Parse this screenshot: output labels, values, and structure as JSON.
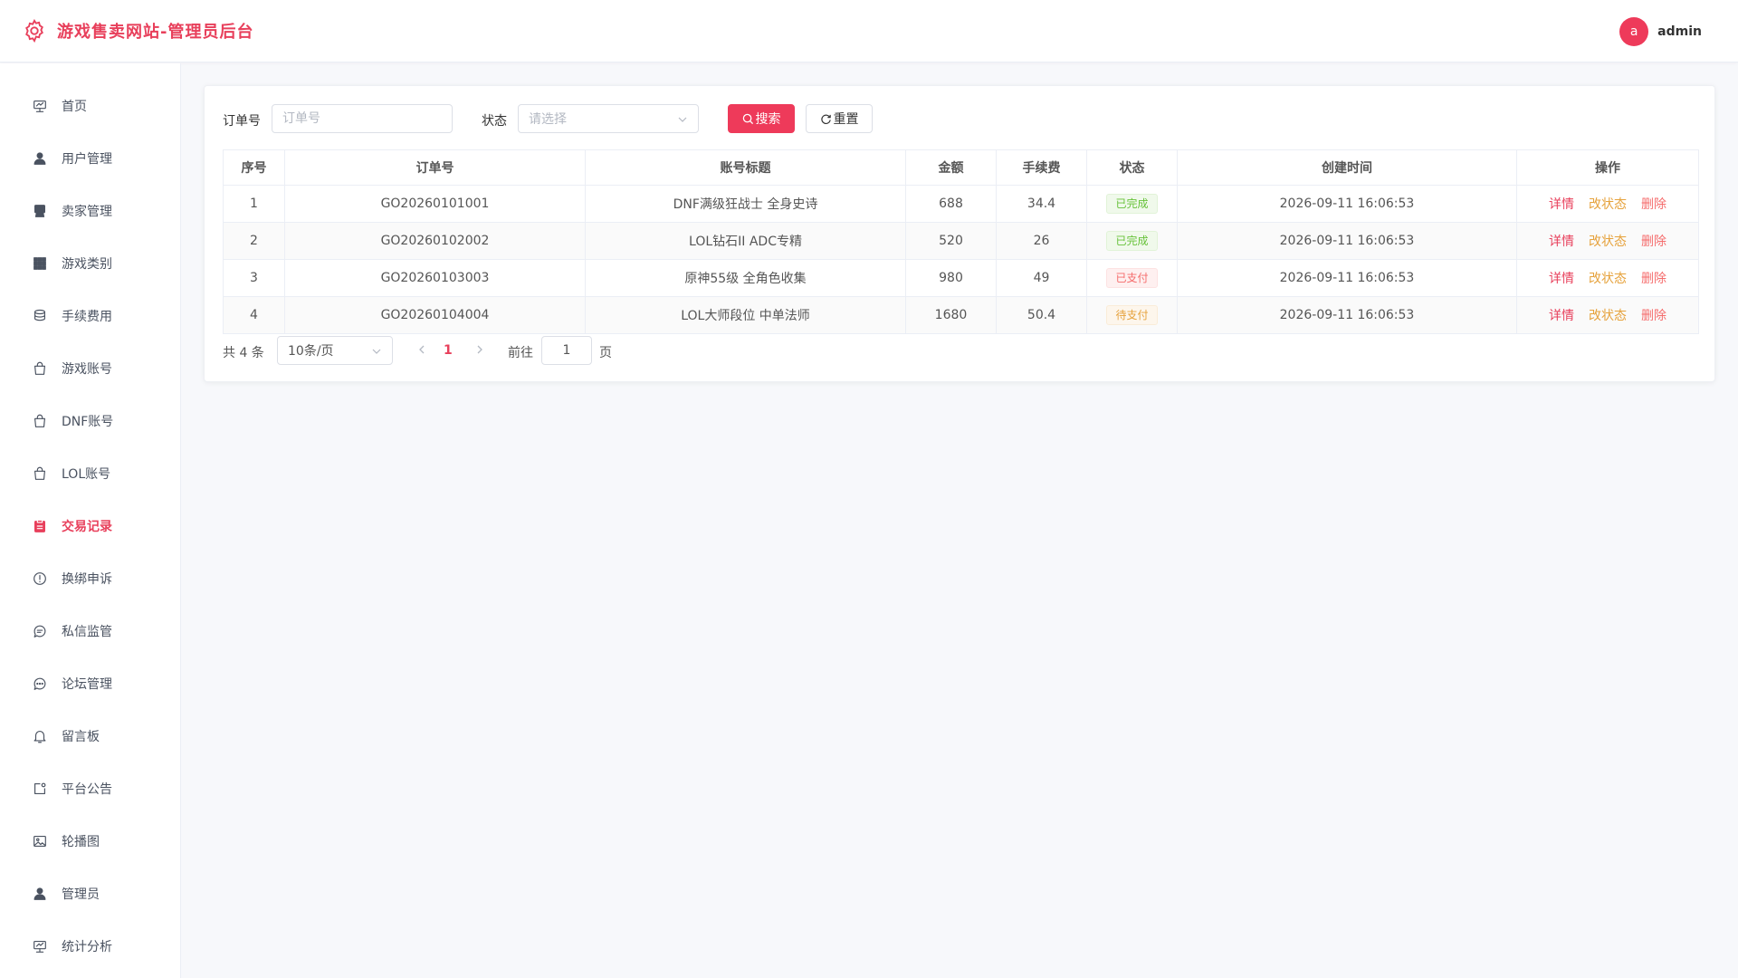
{
  "app": {
    "title": "游戏售卖网站-管理员后台",
    "brand_color": "#e83f5b"
  },
  "user": {
    "avatar_letter": "a",
    "name": "admin"
  },
  "sidebar": {
    "items": [
      {
        "label": "首页",
        "icon": "presentation-icon"
      },
      {
        "label": "用户管理",
        "icon": "user-icon"
      },
      {
        "label": "卖家管理",
        "icon": "seller-icon"
      },
      {
        "label": "游戏类别",
        "icon": "grid-icon"
      },
      {
        "label": "手续费用",
        "icon": "coins-icon"
      },
      {
        "label": "游戏账号",
        "icon": "bag-icon"
      },
      {
        "label": "DNF账号",
        "icon": "bag-icon"
      },
      {
        "label": "LOL账号",
        "icon": "bag-icon"
      },
      {
        "label": "交易记录",
        "icon": "clipboard-icon",
        "active": true
      },
      {
        "label": "换绑申诉",
        "icon": "alert-circle-icon"
      },
      {
        "label": "私信监管",
        "icon": "message-icon"
      },
      {
        "label": "论坛管理",
        "icon": "chat-dots-icon"
      },
      {
        "label": "留言板",
        "icon": "bell-icon"
      },
      {
        "label": "平台公告",
        "icon": "notice-icon"
      },
      {
        "label": "轮播图",
        "icon": "picture-icon"
      },
      {
        "label": "管理员",
        "icon": "user-icon"
      },
      {
        "label": "统计分析",
        "icon": "presentation-icon"
      }
    ]
  },
  "filters": {
    "order_label": "订单号",
    "order_placeholder": "订单号",
    "order_value": "",
    "status_label": "状态",
    "status_placeholder": "请选择",
    "search_label": "搜索",
    "reset_label": "重置"
  },
  "table": {
    "columns": [
      "序号",
      "订单号",
      "账号标题",
      "金额",
      "手续费",
      "状态",
      "创建时间",
      "操作"
    ],
    "rows": [
      {
        "index": "1",
        "order_no": "GO20260101001",
        "title": "DNF满级狂战士 全身史诗",
        "amount": "688",
        "fee": "34.4",
        "status": "已完成",
        "status_type": "done",
        "created": "2026-09-11 16:06:53"
      },
      {
        "index": "2",
        "order_no": "GO20260102002",
        "title": "LOL钻石II ADC专精",
        "amount": "520",
        "fee": "26",
        "status": "已完成",
        "status_type": "done",
        "created": "2026-09-11 16:06:53"
      },
      {
        "index": "3",
        "order_no": "GO20260103003",
        "title": "原神55级 全角色收集",
        "amount": "980",
        "fee": "49",
        "status": "已支付",
        "status_type": "paid",
        "created": "2026-09-11 16:06:53"
      },
      {
        "index": "4",
        "order_no": "GO20260104004",
        "title": "LOL大师段位 中单法师",
        "amount": "1680",
        "fee": "50.4",
        "status": "待支付",
        "status_type": "pending",
        "created": "2026-09-11 16:06:53"
      }
    ],
    "actions": {
      "detail": "详情",
      "change_status": "改状态",
      "delete": "删除"
    }
  },
  "pagination": {
    "total_text": "共 4 条",
    "page_size": "10条/页",
    "current_page": "1",
    "goto_label": "前往",
    "goto_value": "1",
    "page_suffix": "页"
  }
}
